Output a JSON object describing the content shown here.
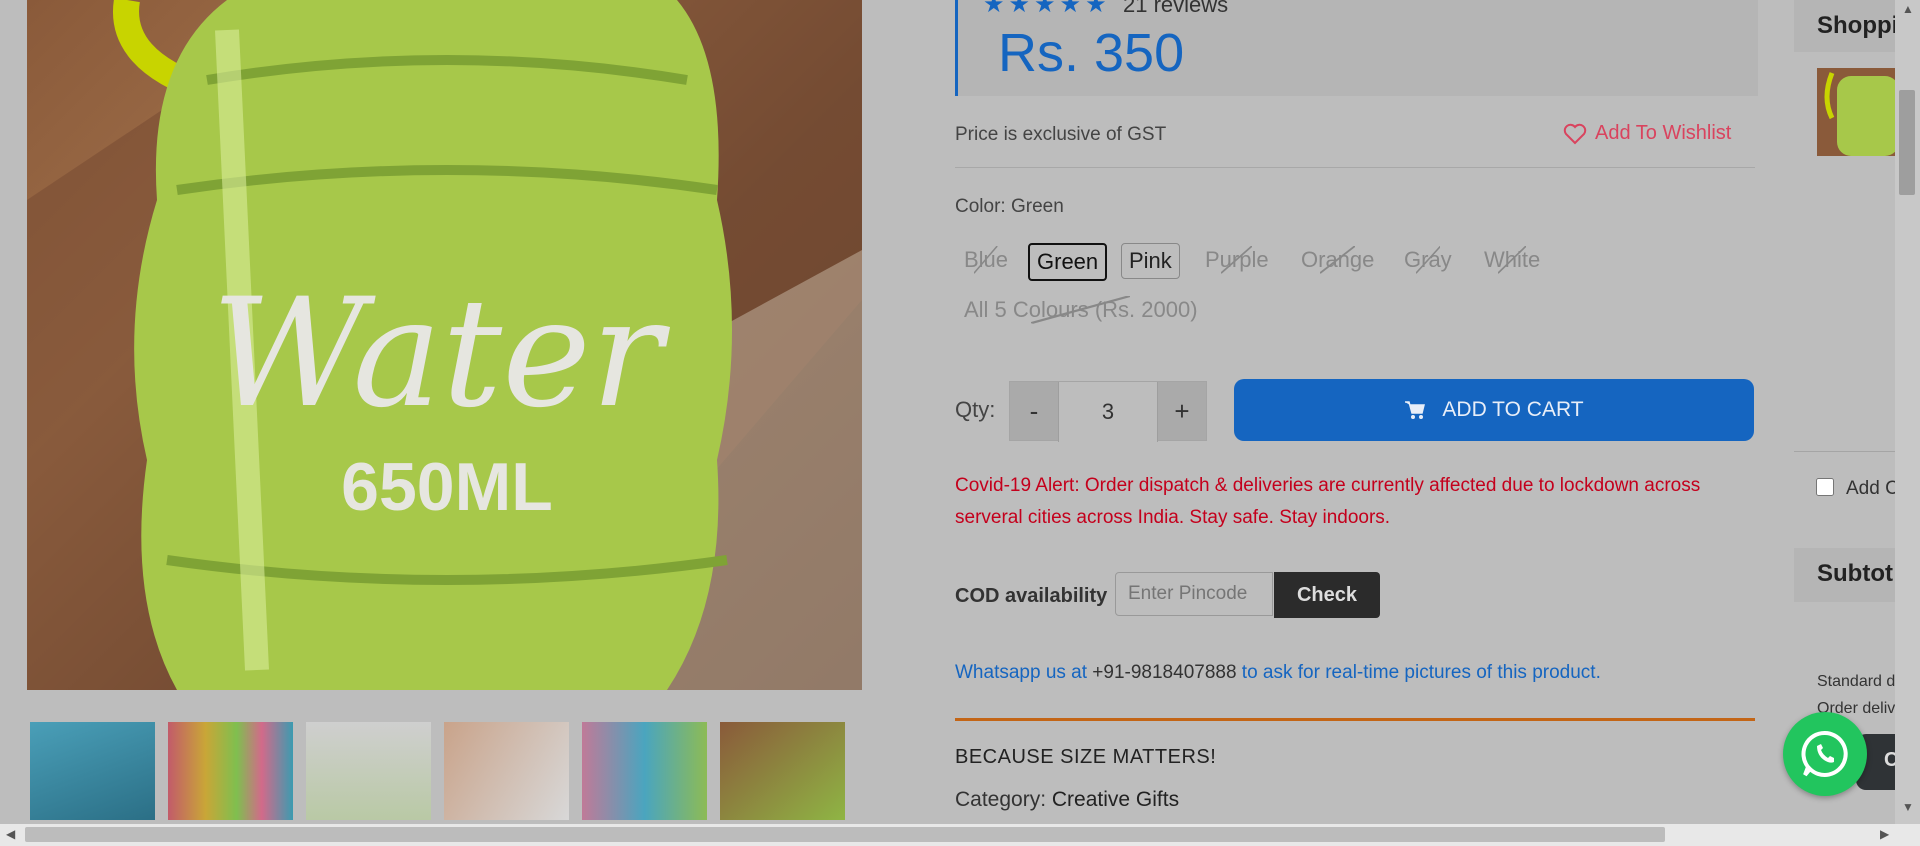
{
  "product": {
    "reviews_label": "21 reviews",
    "price": "Rs. 350",
    "gst_note": "Price is exclusive of GST",
    "wishlist_label": "Add To Wishlist",
    "image_caption": "Water",
    "image_volume": "650ML"
  },
  "color": {
    "label": "Color: Green",
    "options": [
      {
        "label": "Blue",
        "state": "unavailable"
      },
      {
        "label": "Green",
        "state": "selected"
      },
      {
        "label": "Pink",
        "state": "available"
      },
      {
        "label": "Purple",
        "state": "unavailable"
      },
      {
        "label": "Orange",
        "state": "unavailable"
      },
      {
        "label": "Gray",
        "state": "unavailable"
      },
      {
        "label": "White",
        "state": "unavailable"
      },
      {
        "label": "All 5 Colours (Rs. 2000)",
        "state": "unavailable"
      }
    ]
  },
  "quantity": {
    "label": "Qty:",
    "minus": "-",
    "value": "3",
    "plus": "+"
  },
  "cart_button": "ADD TO CART",
  "alert": "Covid-19 Alert: Order dispatch & deliveries are currently affected due to lockdown across serveral cities across India. Stay safe. Stay indoors.",
  "cod": {
    "label": "COD availability",
    "placeholder": "Enter Pincode",
    "check": "Check"
  },
  "whatsapp": {
    "before": "Whatsapp us at ",
    "phone": "+91-9818407888",
    "after": " to ask for real-time pictures of this product."
  },
  "tagline": "BECAUSE SIZE MATTERS!",
  "category": {
    "label": "Category: ",
    "value": "Creative Gifts"
  },
  "drawer": {
    "title": "Shoppi",
    "add_label": "Add C",
    "subtotal": "Subtot",
    "standard_line1": "Standard d",
    "standard_line2": "Order deliv",
    "tab_label": "C"
  },
  "colors": {
    "accent": "#1565c0",
    "alert": "#c4001c",
    "wishlist": "#d9435e",
    "divider": "#c36516",
    "whatsapp": "#22c55e"
  },
  "icons": [
    "star-icon",
    "heart-icon",
    "cart-icon",
    "whatsapp-icon"
  ]
}
